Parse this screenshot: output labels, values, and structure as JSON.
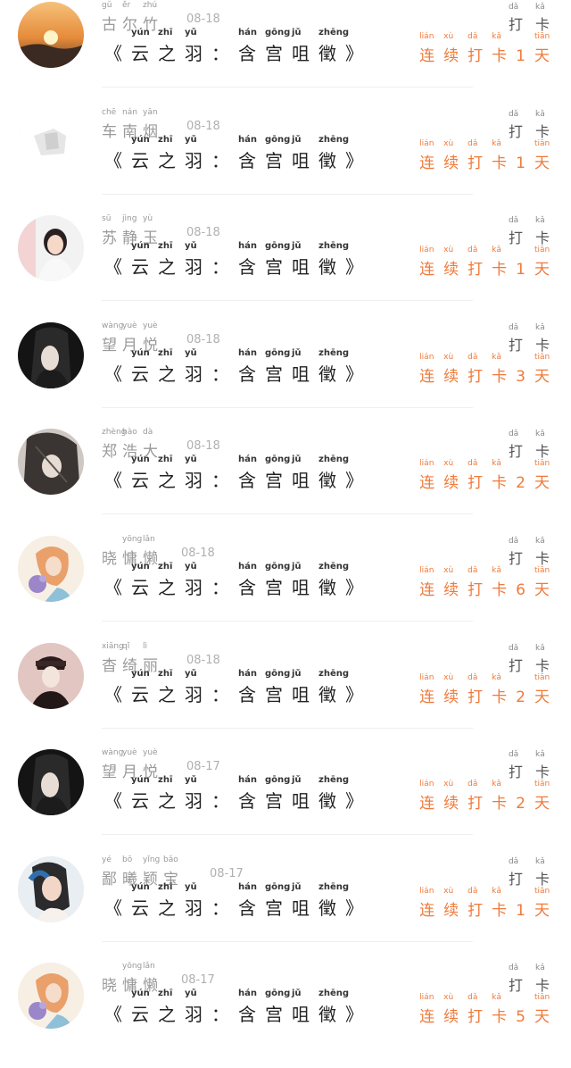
{
  "book_title": "《云之羽：含宫咀徵》",
  "book_chars": [
    {
      "ch": "《",
      "py": ""
    },
    {
      "ch": "云",
      "py": "yún"
    },
    {
      "ch": "之",
      "py": "zhī"
    },
    {
      "ch": "羽",
      "py": "yǔ"
    },
    {
      "ch": "：",
      "py": ""
    },
    {
      "ch": "含",
      "py": "hán"
    },
    {
      "ch": "宫",
      "py": "gōng"
    },
    {
      "ch": "咀",
      "py": "jǔ"
    },
    {
      "ch": "徵",
      "py": "zhēng"
    },
    {
      "ch": "》",
      "py": ""
    }
  ],
  "daka_label": "打卡",
  "daka_chars": [
    {
      "ch": "打",
      "py": "dǎ"
    },
    {
      "ch": "卡",
      "py": "kǎ"
    }
  ],
  "entries": [
    {
      "name": "古尔竹",
      "name_chars": [
        {
          "ch": "古",
          "py": "gǔ"
        },
        {
          "ch": "尔",
          "py": "ěr"
        },
        {
          "ch": "竹",
          "py": "zhú"
        }
      ],
      "date": "08-18",
      "streak": "连续打卡1天",
      "streak_days": "1",
      "avatar": "sunset-avatar"
    },
    {
      "name": "车南烟",
      "name_chars": [
        {
          "ch": "车",
          "py": "chē"
        },
        {
          "ch": "南",
          "py": "nán"
        },
        {
          "ch": "烟",
          "py": "yān"
        }
      ],
      "date": "08-18",
      "streak": "连续打卡1天",
      "streak_days": "1",
      "avatar": "sketch-avatar"
    },
    {
      "name": "苏静玉",
      "name_chars": [
        {
          "ch": "苏",
          "py": "sū"
        },
        {
          "ch": "静",
          "py": "jìng"
        },
        {
          "ch": "玉",
          "py": "yù"
        }
      ],
      "date": "08-18",
      "streak": "连续打卡1天",
      "streak_days": "1",
      "avatar": "girl-avatar"
    },
    {
      "name": "望月悦",
      "name_chars": [
        {
          "ch": "望",
          "py": "wàng"
        },
        {
          "ch": "月",
          "py": "yuè"
        },
        {
          "ch": "悦",
          "py": "yuè"
        }
      ],
      "date": "08-18",
      "streak": "连续打卡3天",
      "streak_days": "3",
      "avatar": "dark-avatar"
    },
    {
      "name": "郑浩大",
      "name_chars": [
        {
          "ch": "郑",
          "py": "zhèng"
        },
        {
          "ch": "浩",
          "py": "hào"
        },
        {
          "ch": "大",
          "py": "dà"
        }
      ],
      "date": "08-18",
      "streak": "连续打卡2天",
      "streak_days": "2",
      "avatar": "anime-avatar"
    },
    {
      "name": "晓慵懒",
      "name_chars": [
        {
          "ch": "晓",
          "py": ""
        },
        {
          "ch": "慵",
          "py": "yōng"
        },
        {
          "ch": "懒",
          "py": "lǎn"
        }
      ],
      "date": "08-18",
      "streak": "连续打卡6天",
      "streak_days": "6",
      "avatar": "flower-avatar"
    },
    {
      "name": "杳绮丽",
      "name_chars": [
        {
          "ch": "杳",
          "py": "xiāng"
        },
        {
          "ch": "绮",
          "py": "qǐ"
        },
        {
          "ch": "丽",
          "py": "lì"
        }
      ],
      "date": "08-18",
      "streak": "连续打卡2天",
      "streak_days": "2",
      "avatar": "boy-avatar"
    },
    {
      "name": "望月悦",
      "name_chars": [
        {
          "ch": "望",
          "py": "wàng"
        },
        {
          "ch": "月",
          "py": "yuè"
        },
        {
          "ch": "悦",
          "py": "yuè"
        }
      ],
      "date": "08-17",
      "streak": "连续打卡2天",
      "streak_days": "2",
      "avatar": "dark-avatar"
    },
    {
      "name": "鄙曦颖宝",
      "name_chars": [
        {
          "ch": "鄙",
          "py": "yé"
        },
        {
          "ch": "曦",
          "py": "bō"
        },
        {
          "ch": "颖",
          "py": "yǐng"
        },
        {
          "ch": "宝",
          "py": "bǎo"
        }
      ],
      "date": "08-17",
      "streak": "连续打卡1天",
      "streak_days": "1",
      "avatar": "woman-avatar"
    },
    {
      "name": "晓慵懒",
      "name_chars": [
        {
          "ch": "晓",
          "py": ""
        },
        {
          "ch": "慵",
          "py": "yōng"
        },
        {
          "ch": "懒",
          "py": "lǎn"
        }
      ],
      "date": "08-17",
      "streak": "连续打卡5天",
      "streak_days": "5",
      "avatar": "flower-avatar"
    }
  ],
  "streak_pinyin": [
    "lián",
    "xù",
    "dǎ",
    "kǎ",
    "",
    "tiān"
  ],
  "colors": {
    "streak": "#f07a3a",
    "name": "#9a9a9a",
    "date": "#b0b0b0",
    "title": "#222222",
    "divider": "#efefef"
  }
}
